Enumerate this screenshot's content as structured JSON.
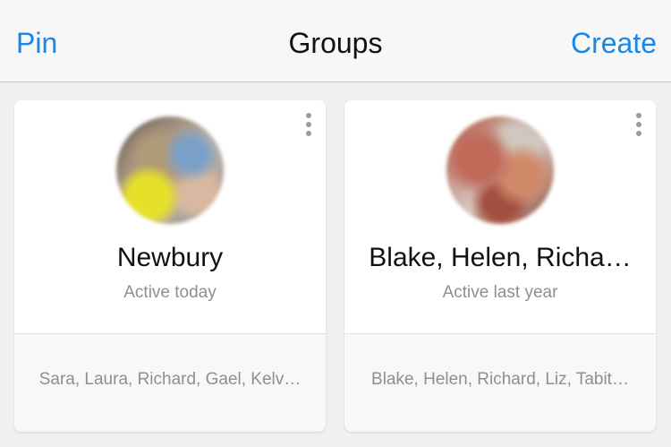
{
  "nav": {
    "left_label": "Pin",
    "title": "Groups",
    "right_label": "Create"
  },
  "colors": {
    "accent": "#1b86e8",
    "secondary_text": "#8e8e93",
    "background": "#f0f0f2"
  },
  "groups": [
    {
      "name": "Newbury",
      "status": "Active today",
      "members": "Sara, Laura, Richard, Gael, Kelv…"
    },
    {
      "name": "Blake, Helen, Richa…",
      "status": "Active last year",
      "members": "Blake, Helen, Richard, Liz, Tabit…"
    }
  ]
}
